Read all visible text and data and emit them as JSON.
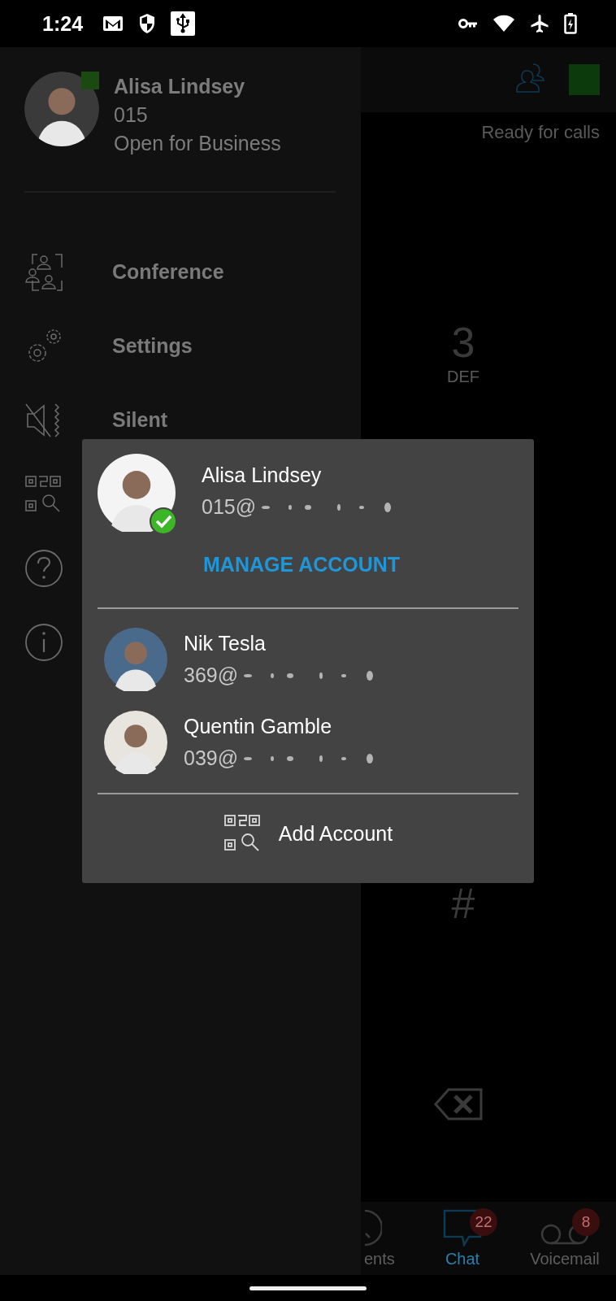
{
  "status_bar": {
    "time": "1:24"
  },
  "app": {
    "status_text": "Ready for calls",
    "keys": [
      {
        "digit": "3",
        "letters": "DEF"
      },
      {
        "digit": "#"
      }
    ],
    "tabs": [
      {
        "kind": "recents",
        "label": "ents",
        "selected": false
      },
      {
        "kind": "chat",
        "label": "Chat",
        "selected": true,
        "badge": "22"
      },
      {
        "kind": "voicemail",
        "label": "Voicemail",
        "selected": false,
        "badge": "8"
      }
    ]
  },
  "drawer": {
    "user": {
      "name": "Alisa Lindsey",
      "extension": "015",
      "status": "Open for Business"
    },
    "items": [
      {
        "kind": "conference",
        "label": "Conference"
      },
      {
        "kind": "settings",
        "label": "Settings"
      },
      {
        "kind": "silent",
        "label": "Silent"
      },
      {
        "kind": "qr"
      },
      {
        "kind": "help"
      },
      {
        "kind": "info"
      }
    ]
  },
  "account_popup": {
    "accounts": [
      {
        "name": "Alisa Lindsey",
        "address": "015@",
        "selected": true
      },
      {
        "name": "Nik Tesla",
        "address": "369@",
        "selected": false
      },
      {
        "name": "Quentin Gamble",
        "address": "039@",
        "selected": false
      }
    ],
    "manage_label": "MANAGE ACCOUNT",
    "add_label": "Add Account"
  }
}
